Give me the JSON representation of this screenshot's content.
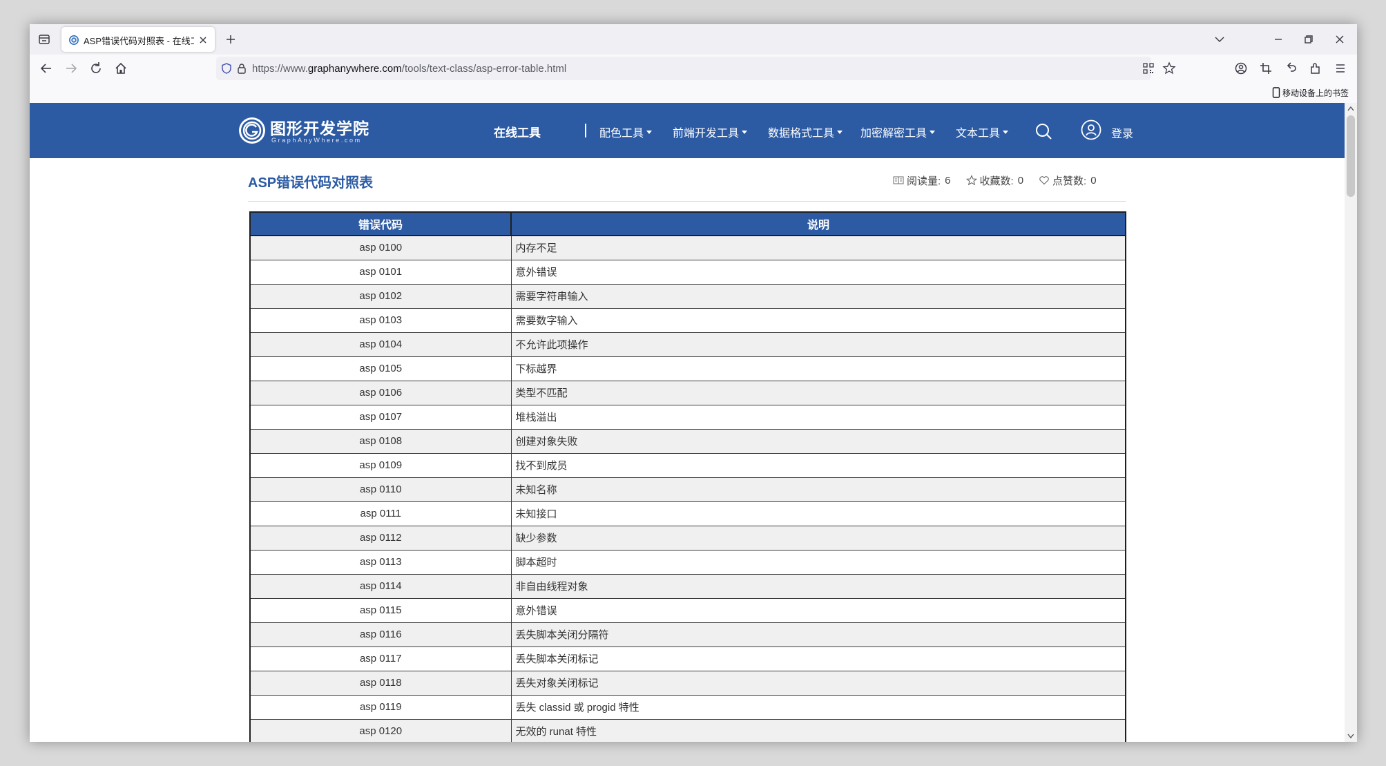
{
  "browser": {
    "tab": {
      "title": "ASP错误代码对照表 - 在线工具"
    },
    "url": {
      "prefix": "https://www.",
      "host": "graphanywhere.com",
      "path": "/tools/text-class/asp-error-table.html"
    },
    "bookmarks_bar": {
      "mobile_bookmarks_label": "移动设备上的书签"
    }
  },
  "site": {
    "logo": {
      "title": "图形开发学院",
      "subtitle": "GraphAnyWhere.com"
    },
    "menu": {
      "home": "在线工具",
      "items": [
        "配色工具",
        "前端开发工具",
        "数据格式工具",
        "加密解密工具",
        "文本工具"
      ],
      "login": "登录"
    }
  },
  "page": {
    "title": "ASP错误代码对照表",
    "stats": {
      "views_label": "阅读量:",
      "views": "6",
      "favorites_label": "收藏数:",
      "favorites": "0",
      "likes_label": "点赞数:",
      "likes": "0"
    },
    "table": {
      "headers": [
        "错误代码",
        "说明"
      ],
      "rows": [
        [
          "asp 0100",
          "内存不足"
        ],
        [
          "asp 0101",
          "意外错误"
        ],
        [
          "asp 0102",
          "需要字符串输入"
        ],
        [
          "asp 0103",
          "需要数字输入"
        ],
        [
          "asp 0104",
          "不允许此项操作"
        ],
        [
          "asp 0105",
          "下标越界"
        ],
        [
          "asp 0106",
          "类型不匹配"
        ],
        [
          "asp 0107",
          "堆栈溢出"
        ],
        [
          "asp 0108",
          "创建对象失败"
        ],
        [
          "asp 0109",
          "找不到成员"
        ],
        [
          "asp 0110",
          "未知名称"
        ],
        [
          "asp 0111",
          "未知接口"
        ],
        [
          "asp 0112",
          "缺少参数"
        ],
        [
          "asp 0113",
          "脚本超时"
        ],
        [
          "asp 0114",
          "非自由线程对象"
        ],
        [
          "asp 0115",
          "意外错误"
        ],
        [
          "asp 0116",
          "丢失脚本关闭分隔符"
        ],
        [
          "asp 0117",
          "丢失脚本关闭标记"
        ],
        [
          "asp 0118",
          "丢失对象关闭标记"
        ],
        [
          "asp 0119",
          "丢失 classid 或 progid 特性"
        ],
        [
          "asp 0120",
          "无效的 runat 特性"
        ]
      ]
    }
  },
  "colors": {
    "brand": "#2c5ba4",
    "row_alt": "#f0f0f0"
  }
}
